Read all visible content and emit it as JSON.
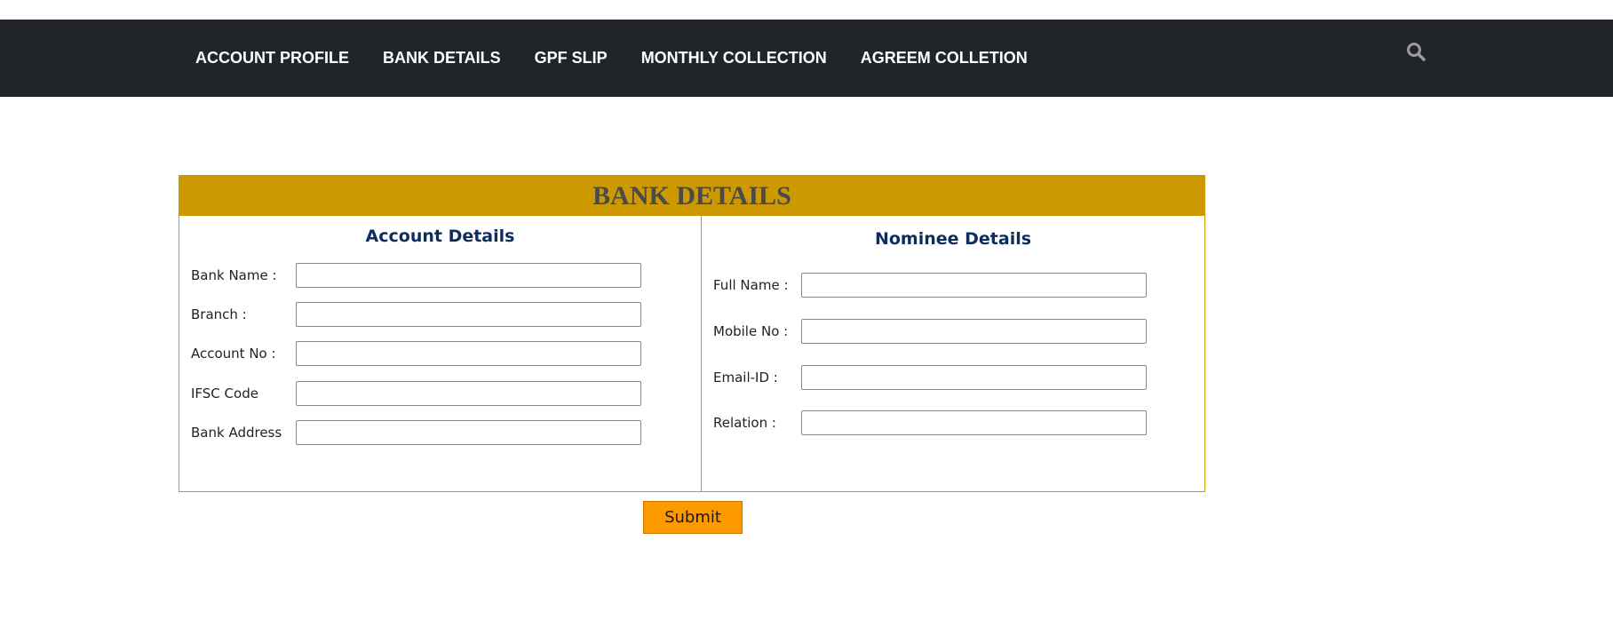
{
  "nav": {
    "items": [
      {
        "label": "ACCOUNT PROFILE"
      },
      {
        "label": "BANK DETAILS"
      },
      {
        "label": "GPF SLIP"
      },
      {
        "label": "MONTHLY COLLECTION"
      },
      {
        "label": "AGREEM COLLETION"
      }
    ],
    "search_icon": "search-icon"
  },
  "panel": {
    "title": "BANK DETAILS",
    "account": {
      "title": "Account Details",
      "fields": [
        {
          "label": "Bank Name :",
          "value": ""
        },
        {
          "label": "Branch :",
          "value": ""
        },
        {
          "label": "Account No :",
          "value": ""
        },
        {
          "label": "IFSC Code",
          "value": ""
        },
        {
          "label": "Bank Address",
          "value": ""
        }
      ]
    },
    "nominee": {
      "title": "Nominee Details",
      "fields": [
        {
          "label": "Full Name :",
          "value": ""
        },
        {
          "label": "Mobile No :",
          "value": ""
        },
        {
          "label": "Email-ID :",
          "value": ""
        },
        {
          "label": "Relation :",
          "value": ""
        }
      ]
    }
  },
  "submit": {
    "label": "Submit"
  },
  "colors": {
    "navbar": "#212529",
    "accent": "#cc9900",
    "button": "#ff9900",
    "heading": "#0d2e5c"
  }
}
